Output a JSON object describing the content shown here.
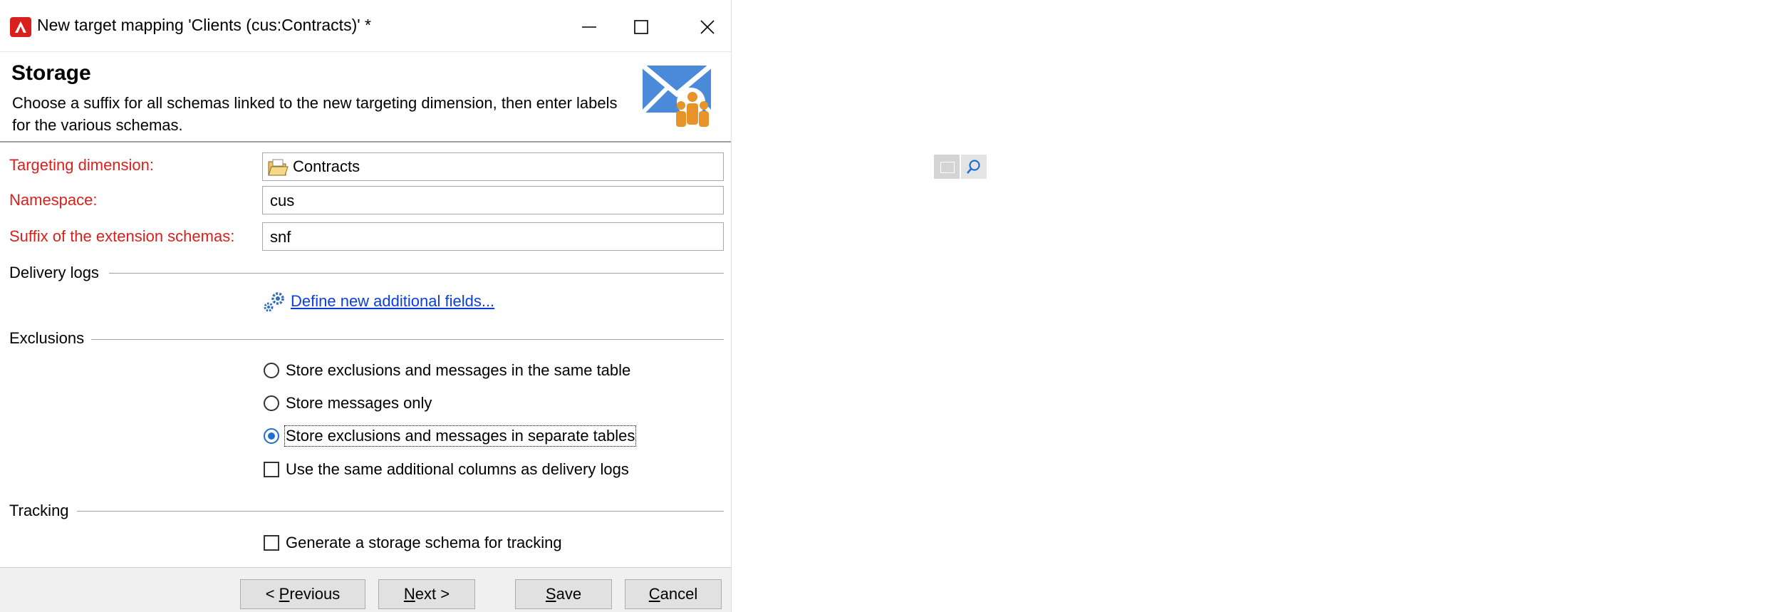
{
  "window": {
    "title": "New target mapping 'Clients (cus:Contracts)' *",
    "app_icon": "adobe-campaign-icon",
    "controls": [
      "minimize-icon",
      "maximize-icon",
      "close-icon"
    ]
  },
  "header": {
    "title": "Storage",
    "description": "Choose a suffix for all schemas linked to the new targeting dimension, then enter labels for the various schemas.",
    "logo": "mail-audience-icon"
  },
  "form": {
    "targeting_dimension": {
      "label": "Targeting dimension:",
      "value": "Contracts"
    },
    "namespace": {
      "label": "Namespace:",
      "value": "cus"
    },
    "suffix": {
      "label": "Suffix of the extension schemas:",
      "value": "snf"
    }
  },
  "delivery_logs": {
    "section_label": "Delivery logs",
    "link": "Define new additional fields..."
  },
  "exclusions": {
    "section_label": "Exclusions",
    "options": [
      {
        "label": "Store exclusions and messages in the same table",
        "selected": false
      },
      {
        "label": "Store messages only",
        "selected": false
      },
      {
        "label": "Store exclusions and messages in separate tables",
        "selected": true
      }
    ],
    "checkbox": {
      "label": "Use the same additional columns as delivery logs",
      "checked": false
    }
  },
  "tracking": {
    "section_label": "Tracking",
    "checkbox": {
      "label": "Generate a storage schema for tracking",
      "checked": false
    }
  },
  "footer": {
    "previous": {
      "prefix": "< ",
      "accel": "P",
      "rest": "revious"
    },
    "next": {
      "accel": "N",
      "rest": "ext >"
    },
    "save": {
      "accel": "S",
      "rest": "ave"
    },
    "cancel": {
      "accel": "C",
      "rest": "ancel"
    }
  },
  "colors": {
    "required_label": "#d9211c",
    "link": "#0b3fd6",
    "radio_selected": "#1f6fd1"
  }
}
